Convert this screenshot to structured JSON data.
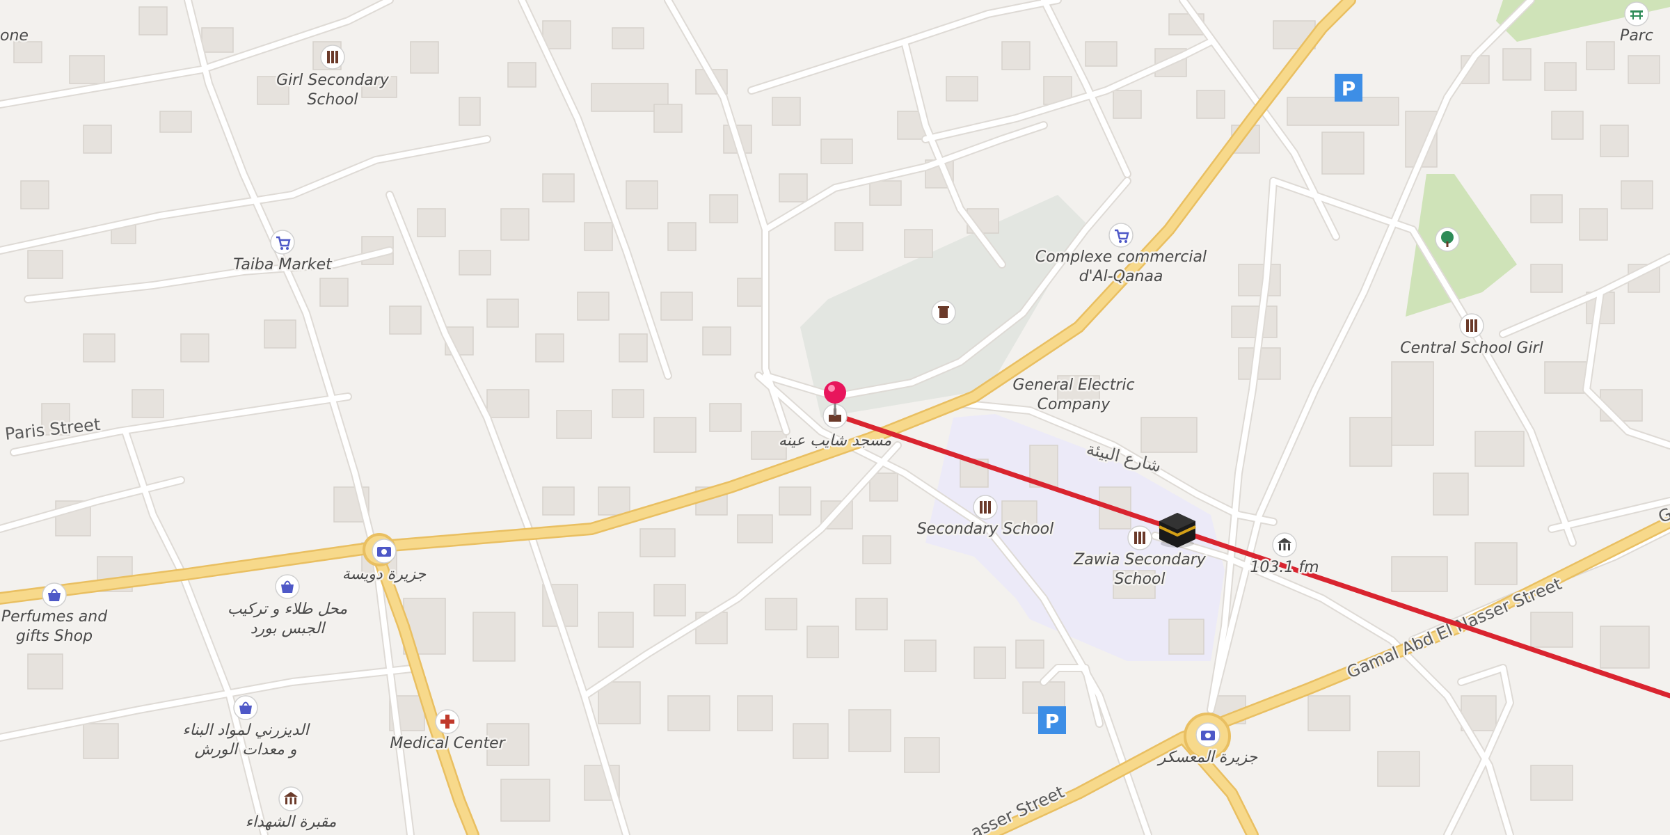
{
  "map": {
    "colors": {
      "background": "#f3f1ee",
      "building": "#e6e2dd",
      "building_stroke": "#d6d1cb",
      "minor_road": "#ffffff",
      "road_casing": "#dedad5",
      "major_road": "#f7d98b",
      "major_road_casing": "#e9bf61",
      "park": "#cfe3b8",
      "cemetery": "#e3e6e1",
      "school_area": "#eceaf8",
      "route_line": "#d9242f",
      "pin": "#e8155c",
      "parking": "#3d8ee6",
      "shop_icon": "#4e58c7",
      "medical_icon": "#c0392b"
    },
    "street_labels": {
      "paris_street": "Paris Street",
      "gamal_abd_el_nasser": "Gamal Abd El Nasser Street",
      "arabic_street": "شارع البيئة",
      "bottom_street": "asser Street",
      "top_left_cut": "one",
      "right_edge_cut": "G",
      "parc": "Parc"
    },
    "poi_labels": {
      "girl_secondary_school": [
        "Girl Secondary",
        "School"
      ],
      "taiba_market": "Taiba Market",
      "complexe_commercial": [
        "Complexe commercial",
        "d'Al-Qanaa"
      ],
      "central_school_girl": "Central School Girl",
      "general_electric": [
        "General Electric",
        "Company"
      ],
      "mosque": "مسجد شايب عينه",
      "secondary_school": "Secondary School",
      "zawia_secondary": [
        "Zawia Secondary",
        "School"
      ],
      "radio": "103.1 fm",
      "jaziret_dwisa": "جزيرة دويسة",
      "perfumes_shop": [
        "Perfumes and",
        "gifts Shop"
      ],
      "arabic_shop": [
        "محل طلاء و تركيب",
        "الجبس بورد"
      ],
      "building_materials": [
        "الديزرني لمواد البناء",
        "و معدات الورش"
      ],
      "medical_center": "Medical Center",
      "jaziret_al_moaskar": "جزيرة المعسكر",
      "cemetery": "مقبرة الشهداء"
    },
    "icons": {
      "parking": "P",
      "shop": "shopping-cart-icon",
      "bag": "shopping-bag-icon",
      "school": "school-icon",
      "camera": "camera-icon",
      "medical": "medical-cross-icon",
      "trash": "trash-icon",
      "museum": "museum-icon",
      "tree": "tree-icon",
      "picnic": "picnic-table-icon",
      "kaaba": "kaaba-icon",
      "pin": "location-pin-icon"
    }
  }
}
